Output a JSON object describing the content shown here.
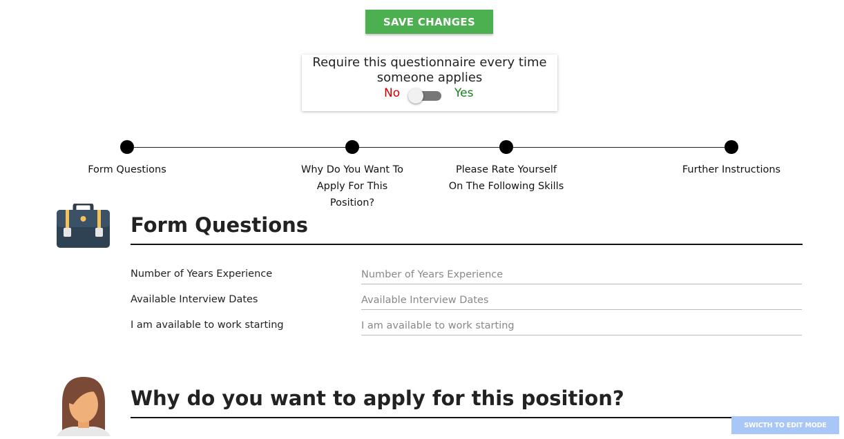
{
  "toolbar": {
    "save_label": "SAVE CHANGES"
  },
  "require": {
    "text": "Require this questionnaire every time someone applies",
    "no_label": "No",
    "yes_label": "Yes",
    "enabled": false
  },
  "steps": [
    {
      "label": "Form Questions"
    },
    {
      "label": "Why Do You Want To Apply For This Position?"
    },
    {
      "label": "Please Rate Yourself On The Following Skills"
    },
    {
      "label": "Further Instructions"
    }
  ],
  "sections": [
    {
      "icon": "briefcase-icon",
      "title": "Form Questions",
      "questions": [
        {
          "label": "Number of Years Experience",
          "placeholder": "Number of Years Experience"
        },
        {
          "label": "Available Interview Dates",
          "placeholder": "Available Interview Dates"
        },
        {
          "label": "I am available to work starting",
          "placeholder": "I am available to work starting"
        }
      ]
    },
    {
      "icon": "woman-avatar-icon",
      "title": "Why do you want to apply for this position?"
    }
  ],
  "footer": {
    "edit_mode_label": "SWICTH TO EDIT MODE"
  },
  "colors": {
    "accent": "#4caf50",
    "no": "#d40000",
    "yes": "#1a7f1a",
    "edit_button": "#a8c6f6"
  }
}
